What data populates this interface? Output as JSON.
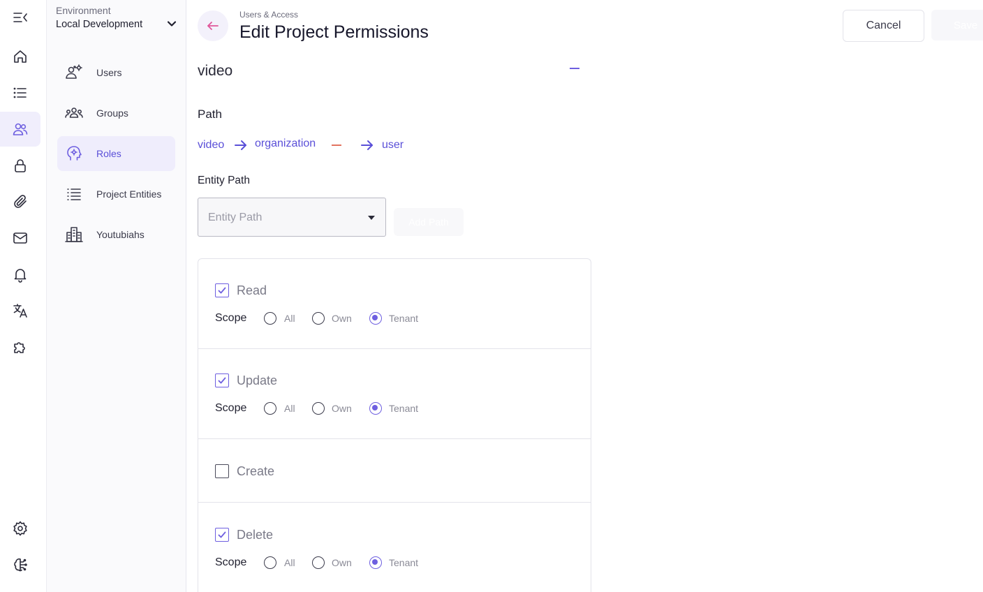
{
  "sidebar": {
    "environment_label": "Environment",
    "environment_value": "Local Development",
    "items": [
      {
        "label": "Users",
        "icon": "users-gear-icon",
        "active": false
      },
      {
        "label": "Groups",
        "icon": "groups-icon",
        "active": false
      },
      {
        "label": "Roles",
        "icon": "roles-head-icon",
        "active": true
      },
      {
        "label": "Project Entities",
        "icon": "list-icon",
        "active": false
      },
      {
        "label": "Youtubiahs",
        "icon": "building-icon",
        "active": false
      }
    ]
  },
  "rail": {
    "items": [
      "menu-collapse-icon",
      "home-icon",
      "list-icon",
      "users-icon",
      "lock-icon",
      "paperclip-icon",
      "mail-icon",
      "bell-icon",
      "translate-icon",
      "puzzle-icon",
      "settings-icon",
      "brain-icon"
    ],
    "active": "users-icon"
  },
  "header": {
    "breadcrumb": "Users & Access",
    "title": "Edit Project Permissions",
    "cancel_label": "Cancel",
    "save_label": "Save"
  },
  "entity": {
    "name": "video",
    "path_heading": "Path",
    "path": [
      "video",
      "organization",
      "user"
    ],
    "entity_path_heading": "Entity Path",
    "entity_path_placeholder": "Entity Path",
    "add_path_label": "Add Path"
  },
  "permissions": [
    {
      "label": "Read",
      "checked": true,
      "scope_label": "Scope",
      "options": [
        "All",
        "Own",
        "Tenant"
      ],
      "selected": "Tenant"
    },
    {
      "label": "Update",
      "checked": true,
      "scope_label": "Scope",
      "options": [
        "All",
        "Own",
        "Tenant"
      ],
      "selected": "Tenant"
    },
    {
      "label": "Create",
      "checked": false
    },
    {
      "label": "Delete",
      "checked": true,
      "scope_label": "Scope",
      "options": [
        "All",
        "Own",
        "Tenant"
      ],
      "selected": "Tenant"
    }
  ],
  "colors": {
    "accent": "#6e5fe0",
    "accent_text": "#5a4fd8",
    "back_arrow": "#e0569a",
    "remove": "#e2735f",
    "active_bg": "#efedfc"
  }
}
